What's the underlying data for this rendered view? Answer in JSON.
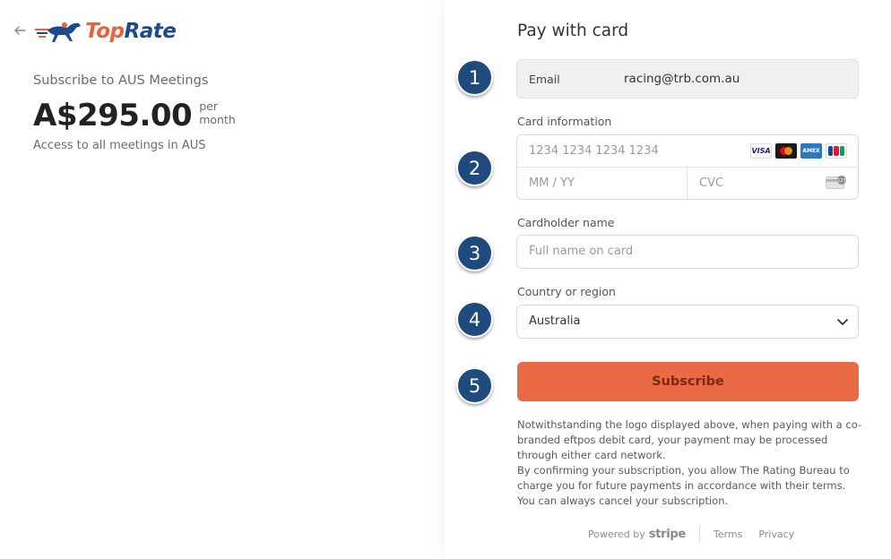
{
  "logo": {
    "part1": "Top",
    "part2": "Rate"
  },
  "product": {
    "subtitle": "Subscribe to AUS Meetings",
    "price": "A$295.00",
    "period_line1": "per",
    "period_line2": "month",
    "description": "Access to all meetings in AUS"
  },
  "form": {
    "title": "Pay with card",
    "email": {
      "label": "Email",
      "value": "racing@trb.com.au"
    },
    "card": {
      "label": "Card information",
      "number_placeholder": "1234 1234 1234 1234",
      "expiry_placeholder": "MM / YY",
      "cvc_placeholder": "CVC",
      "brands": [
        "VISA",
        "mastercard",
        "AMEX",
        "JCB"
      ]
    },
    "cardholder": {
      "label": "Cardholder name",
      "placeholder": "Full name on card"
    },
    "country": {
      "label": "Country or region",
      "value": "Australia"
    },
    "subscribe_label": "Subscribe",
    "legal_text": [
      "Notwithstanding the logo displayed above, when paying with a co-branded eftpos debit card, your payment may be processed through either card network.",
      "By confirming your subscription, you allow The Rating Bureau to charge you for future payments in accordance with their terms. You can always cancel your subscription."
    ]
  },
  "badges": [
    "1",
    "2",
    "3",
    "4",
    "5"
  ],
  "footer": {
    "powered_by": "Powered by",
    "stripe": "stripe",
    "terms": "Terms",
    "privacy": "Privacy"
  },
  "colors": {
    "accent": "#e96a45",
    "badge": "#1f4a7d",
    "brand_blue": "#1d4a8c"
  }
}
